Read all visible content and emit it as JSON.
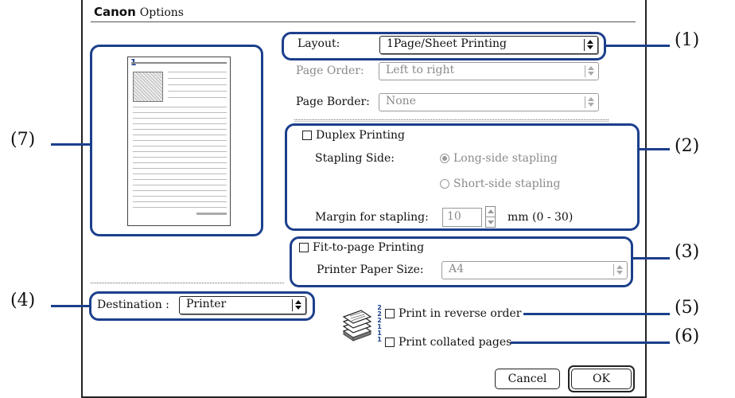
{
  "window": {
    "brand": "Canon",
    "title": "Options"
  },
  "layout": {
    "label": "Layout:",
    "value": "1Page/Sheet Printing"
  },
  "page_order": {
    "label": "Page Order:",
    "value": "Left to right"
  },
  "page_border": {
    "label": "Page Border:",
    "value": "None"
  },
  "duplex": {
    "checkbox_label": "Duplex Printing",
    "stapling_side_label": "Stapling Side:",
    "option_long": "Long-side stapling",
    "option_short": "Short-side stapling",
    "margin_label": "Margin for stapling:",
    "margin_value": "10",
    "margin_unit": "mm (0 - 30)"
  },
  "fit_to_page": {
    "checkbox_label": "Fit-to-page Printing",
    "paper_size_label": "Printer Paper Size:",
    "paper_size_value": "A4"
  },
  "destination": {
    "label": "Destination :",
    "value": "Printer"
  },
  "reverse": {
    "label": "Print in reverse order"
  },
  "collated": {
    "label": "Print collated pages"
  },
  "stack_digits": [
    "2",
    "2",
    "2",
    "1",
    "1",
    "1"
  ],
  "preview": {
    "page_number": "1"
  },
  "buttons": {
    "cancel": "Cancel",
    "ok": "OK"
  },
  "callouts": {
    "c1": "(1)",
    "c2": "(2)",
    "c3": "(3)",
    "c4": "(4)",
    "c5": "(5)",
    "c6": "(6)",
    "c7": "(7)"
  },
  "colors": {
    "callout": "#1c3f8c"
  }
}
